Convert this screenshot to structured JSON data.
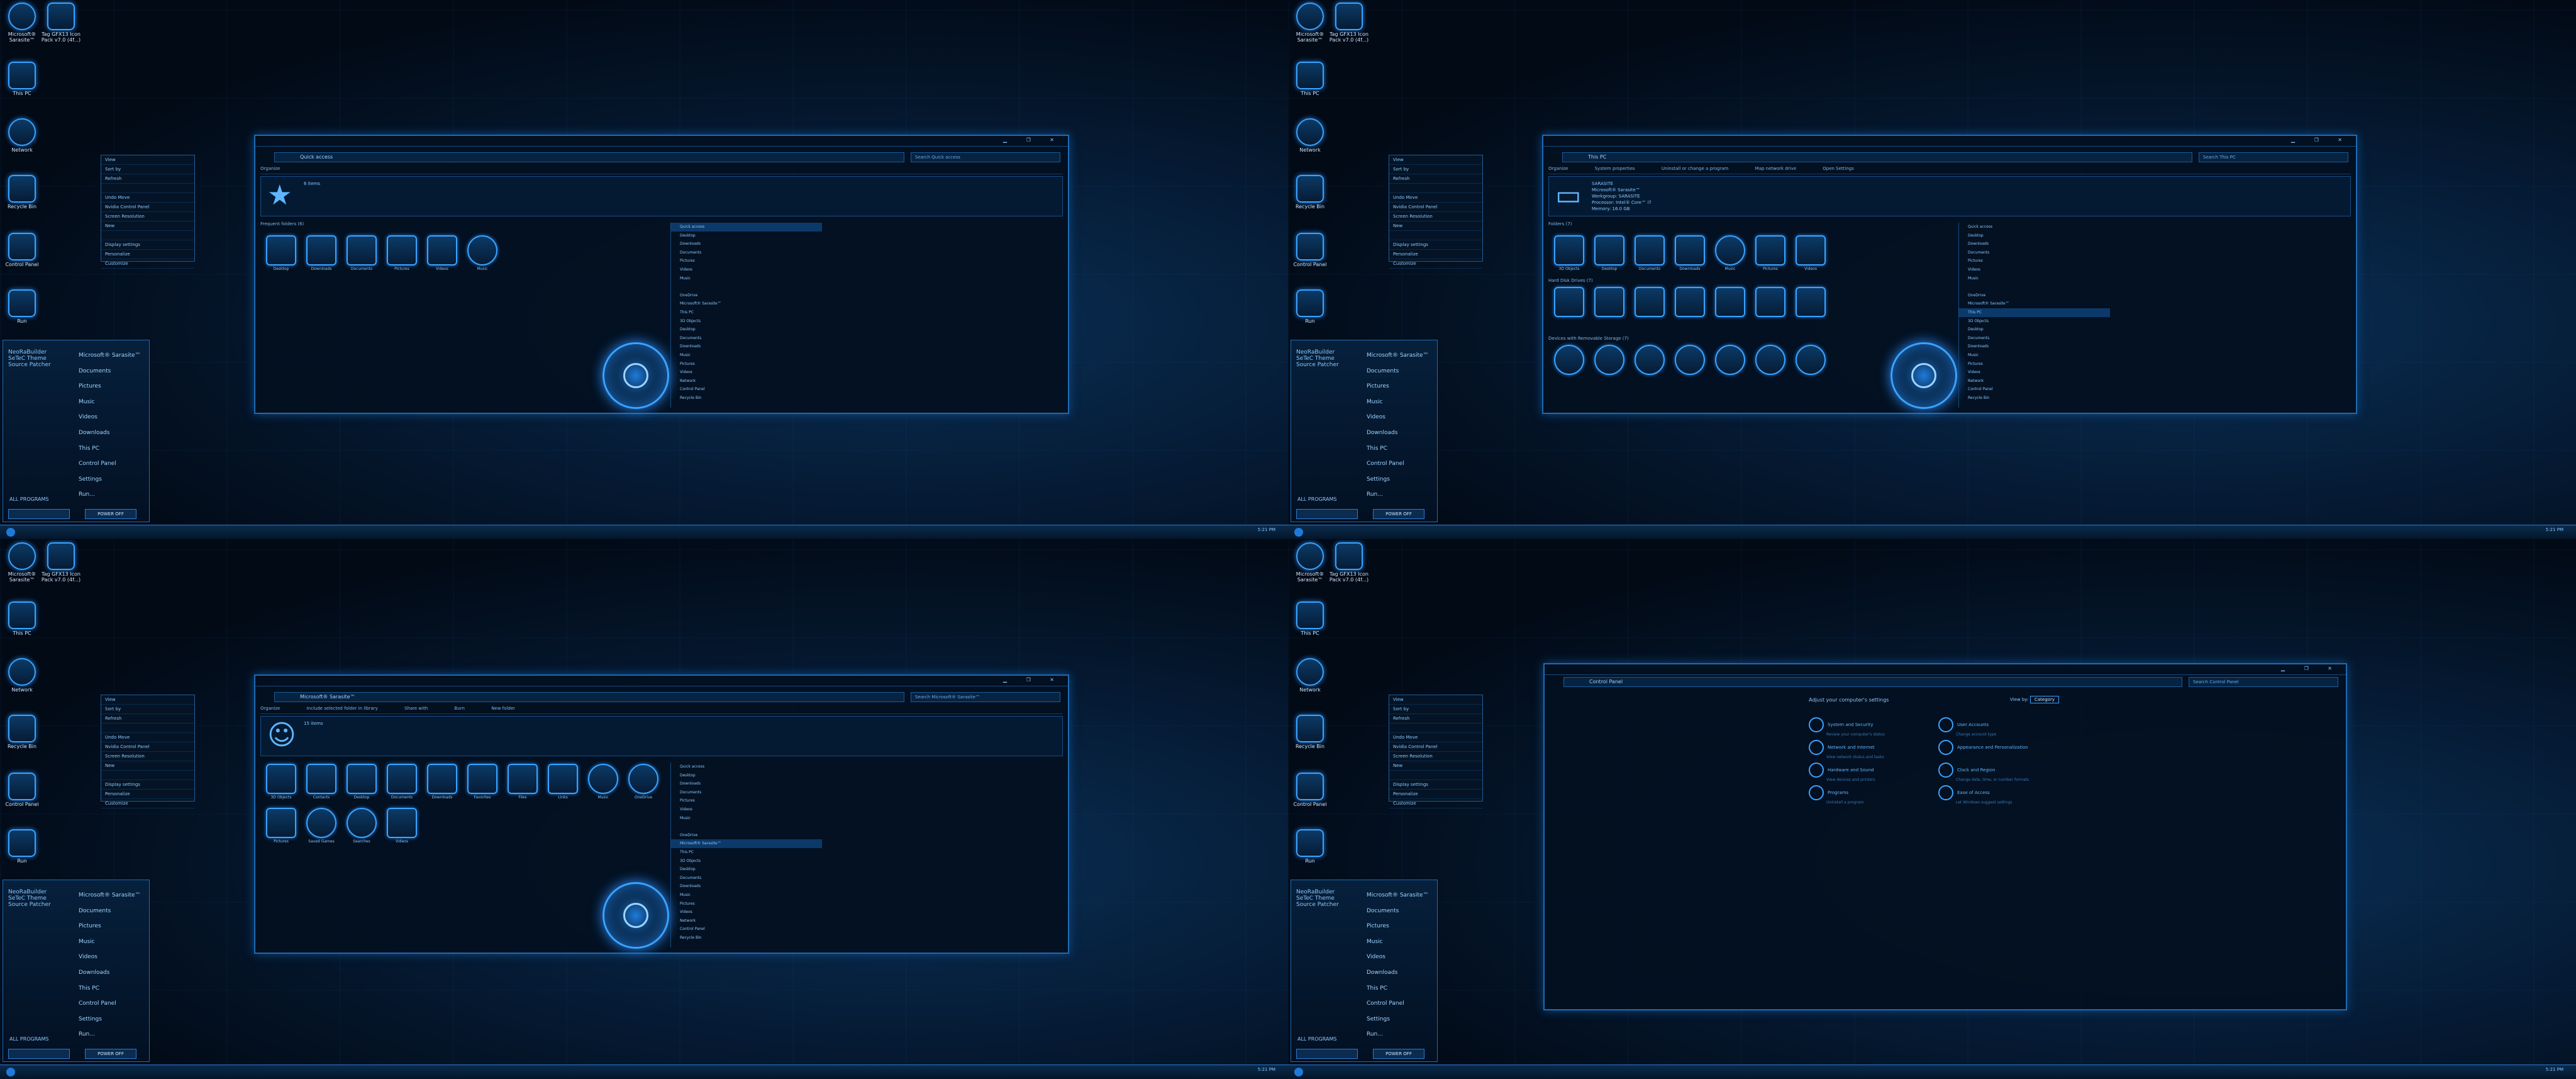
{
  "desktop": {
    "icons": [
      {
        "label": "Microsoft® Sarasite™",
        "icon": "user-icon"
      },
      {
        "label": "Tag GFX13 Icon Pack v7.0 (4f...)",
        "icon": "document-icon"
      },
      {
        "label": "This PC",
        "icon": "monitor-icon"
      },
      {
        "label": "Network",
        "icon": "globe-icon"
      },
      {
        "label": "Recycle Bin",
        "icon": "trash-icon"
      },
      {
        "label": "Control Panel",
        "icon": "sliders-icon"
      },
      {
        "label": "Run",
        "icon": "run-icon"
      }
    ]
  },
  "context_menu": {
    "items": [
      "View",
      "Sort by",
      "Refresh",
      "",
      "Undo Move",
      "Nvidia Control Panel",
      "Screen Resolution",
      "New",
      "",
      "Display settings",
      "Personalize",
      "Customize"
    ]
  },
  "start_menu": {
    "user_lines": [
      "NeoRaBuilder",
      "SeTeC Theme",
      "Source Patcher"
    ],
    "items": [
      "Microsoft® Sarasite™",
      "Documents",
      "Pictures",
      "Music",
      "Videos",
      "Downloads",
      "This PC",
      "Control Panel",
      "Settings",
      "Run..."
    ],
    "all_programs": "ALL PROGRAMS",
    "power_label": "POWER OFF"
  },
  "taskbar": {
    "clock": "5:21 PM"
  },
  "windows": [
    {
      "title": "Quick access",
      "address": "Quick access",
      "search_placeholder": "Search Quick access",
      "toolbar": [
        "Organize"
      ],
      "detail_info": [
        "6 items"
      ],
      "section_label": "Frequent folders (6)",
      "items": [
        {
          "label": "Desktop",
          "icon": "desktop-icon"
        },
        {
          "label": "Downloads",
          "icon": "download-icon"
        },
        {
          "label": "Documents",
          "icon": "document-icon"
        },
        {
          "label": "Pictures",
          "icon": "camera-icon"
        },
        {
          "label": "Videos",
          "icon": "film-icon"
        },
        {
          "label": "Music",
          "icon": "headphones-icon"
        }
      ]
    },
    {
      "title": "This PC",
      "address": "This PC",
      "search_placeholder": "Search This PC",
      "toolbar": [
        "Organize",
        "System properties",
        "Uninstall or change a program",
        "Map network drive",
        "Open Settings"
      ],
      "detail_info": [
        "SARASITE",
        "Microsoft® Sarasite™",
        "Workgroup: SARASITE",
        "Processor: Intel® Core™ i7",
        "Memory: 16.0 GB"
      ],
      "section_label": "Folders (7)",
      "items": [
        {
          "label": "3D Objects",
          "icon": "cube-icon"
        },
        {
          "label": "Desktop",
          "icon": "desktop-icon"
        },
        {
          "label": "Documents",
          "icon": "document-icon"
        },
        {
          "label": "Downloads",
          "icon": "download-icon"
        },
        {
          "label": "Music",
          "icon": "headphones-icon"
        },
        {
          "label": "Pictures",
          "icon": "camera-icon"
        },
        {
          "label": "Videos",
          "icon": "film-icon"
        }
      ],
      "section2_label": "Hard Disk Drives (7)",
      "section3_label": "Devices with Removable Storage (7)"
    },
    {
      "title": "Microsoft® Sarasite™",
      "address": "Microsoft® Sarasite™",
      "search_placeholder": "Search Microsoft® Sarasite™",
      "toolbar": [
        "Organize",
        "Include selected folder in library",
        "Share with",
        "Burn",
        "New folder"
      ],
      "detail_info": [
        "15 items"
      ],
      "section_label": "",
      "items": [
        {
          "label": "3D Objects",
          "icon": "cube-icon"
        },
        {
          "label": "Contacts",
          "icon": "mail-icon"
        },
        {
          "label": "Desktop",
          "icon": "desktop-icon"
        },
        {
          "label": "Documents",
          "icon": "document-icon"
        },
        {
          "label": "Downloads",
          "icon": "download-icon"
        },
        {
          "label": "Favorites",
          "icon": "star-icon"
        },
        {
          "label": "Files",
          "icon": "folder-icon"
        },
        {
          "label": "Links",
          "icon": "link-icon"
        },
        {
          "label": "Music",
          "icon": "headphones-icon"
        },
        {
          "label": "OneDrive",
          "icon": "cloud-icon"
        },
        {
          "label": "Pictures",
          "icon": "camera-icon"
        },
        {
          "label": "Saved Games",
          "icon": "gamepad-icon"
        },
        {
          "label": "Searches",
          "icon": "magnifier-icon"
        },
        {
          "label": "Videos",
          "icon": "film-icon"
        }
      ]
    },
    {
      "title": "Control Panel",
      "address": "Control Panel",
      "search_placeholder": "Search Control Panel",
      "heading": "Adjust your computer's settings",
      "view_by_label": "View by:",
      "view_by_value": "Category",
      "categories": [
        {
          "label": "System and Security",
          "sub": "Review your computer's status"
        },
        {
          "label": "Network and Internet",
          "sub": "View network status and tasks"
        },
        {
          "label": "Hardware and Sound",
          "sub": "View devices and printers"
        },
        {
          "label": "Programs",
          "sub": "Uninstall a program"
        },
        {
          "label": "User Accounts",
          "sub": "Change account type"
        },
        {
          "label": "Appearance and Personalization",
          "sub": ""
        },
        {
          "label": "Clock and Region",
          "sub": "Change date, time, or number formats"
        },
        {
          "label": "Ease of Access",
          "sub": "Let Windows suggest settings"
        }
      ]
    }
  ],
  "nav_pane": [
    "Quick access",
    "Desktop",
    "Downloads",
    "Documents",
    "Pictures",
    "Videos",
    "Music",
    "",
    "OneDrive",
    "Microsoft® Sarasite™",
    "This PC",
    "3D Objects",
    "Desktop",
    "Documents",
    "Downloads",
    "Music",
    "Pictures",
    "Videos",
    "Network",
    "Control Panel",
    "Recycle Bin"
  ],
  "colors": {
    "accent": "#3aa3ff",
    "background": "#02070f",
    "panel": "#031020"
  }
}
